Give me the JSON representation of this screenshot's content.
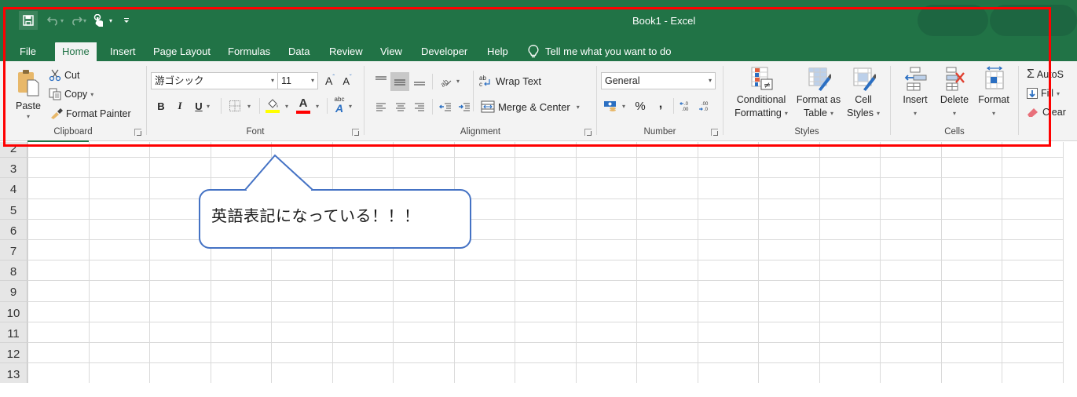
{
  "app": {
    "title": "Book1  -  Excel",
    "colors": {
      "brand": "#217346",
      "highlight_box": "#ff0000",
      "callout_border": "#4472c4"
    }
  },
  "quick_access": {
    "items": [
      {
        "name": "save",
        "icon": "save-icon"
      },
      {
        "name": "undo",
        "icon": "undo-icon"
      },
      {
        "name": "redo",
        "icon": "redo-icon"
      },
      {
        "name": "touch-mode",
        "icon": "touch-mode-icon"
      },
      {
        "name": "customize",
        "icon": "customize-icon"
      }
    ]
  },
  "tabs": [
    {
      "label": "File"
    },
    {
      "label": "Home",
      "active": true
    },
    {
      "label": "Insert"
    },
    {
      "label": "Page Layout"
    },
    {
      "label": "Formulas"
    },
    {
      "label": "Data"
    },
    {
      "label": "Review"
    },
    {
      "label": "View"
    },
    {
      "label": "Developer"
    },
    {
      "label": "Help"
    }
  ],
  "tell_me": {
    "placeholder": "Tell me what you want to do",
    "icon": "lightbulb-icon"
  },
  "ribbon": {
    "clipboard": {
      "label": "Clipboard",
      "paste": "Paste",
      "cut": "Cut",
      "copy": "Copy",
      "format_painter": "Format Painter"
    },
    "font": {
      "label": "Font",
      "font_name": "游ゴシック",
      "font_size": "11",
      "bold": "B",
      "italic": "I",
      "underline": "U",
      "grow": "A",
      "shrink": "A",
      "font_color": "A",
      "highlight_color": "#ffff00",
      "text_color": "#ff0000",
      "phonetic": "abc"
    },
    "alignment": {
      "label": "Alignment",
      "wrap_text": "Wrap Text",
      "merge_center": "Merge & Center",
      "wrap_icon": "ab"
    },
    "number": {
      "label": "Number",
      "format": "General",
      "percent": "%",
      "comma": ",",
      "inc_decimal": ".00",
      "dec_decimal": ".0"
    },
    "styles": {
      "label": "Styles",
      "conditional_formatting": [
        "Conditional",
        "Formatting"
      ],
      "format_as_table": [
        "Format as",
        "Table"
      ],
      "cell_styles": [
        "Cell",
        "Styles"
      ]
    },
    "cells": {
      "label": "Cells",
      "insert": "Insert",
      "delete": "Delete",
      "format": "Format"
    },
    "editing": {
      "autosum": "AutoS",
      "fill": "Fill",
      "clear": "Clear"
    }
  },
  "sheet": {
    "row_numbers": [
      "2",
      "3",
      "4",
      "5",
      "6",
      "7",
      "8",
      "9",
      "10",
      "11",
      "12",
      "13"
    ]
  },
  "callout": {
    "text": "英語表記になっている！！！"
  }
}
